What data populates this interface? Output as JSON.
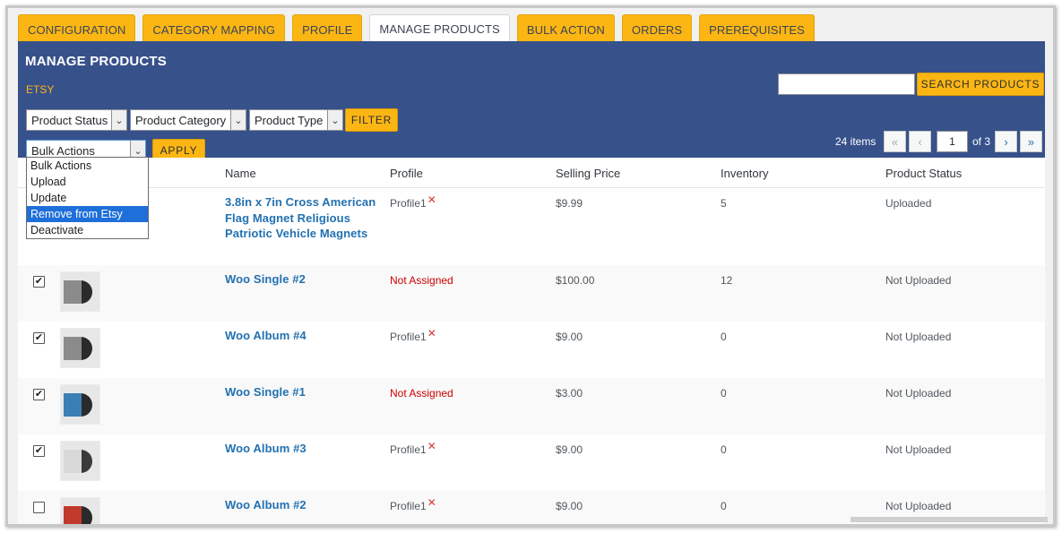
{
  "tabs": [
    {
      "label": "CONFIGURATION"
    },
    {
      "label": "CATEGORY MAPPING"
    },
    {
      "label": "PROFILE"
    },
    {
      "label": "MANAGE PRODUCTS"
    },
    {
      "label": "BULK ACTION"
    },
    {
      "label": "ORDERS"
    },
    {
      "label": "PREREQUISITES"
    }
  ],
  "active_tab": "MANAGE PRODUCTS",
  "panel": {
    "title": "MANAGE PRODUCTS",
    "subtitle": "ETSY",
    "search_button": "SEARCH PRODUCTS",
    "search_value": ""
  },
  "filters": {
    "status": "Product Status",
    "category": "Product Category",
    "type": "Product Type",
    "filter_button": "FILTER"
  },
  "bulk": {
    "selected": "Bulk Actions",
    "apply_button": "APPLY",
    "options": [
      "Bulk Actions",
      "Upload",
      "Update",
      "Remove from Etsy",
      "Deactivate"
    ],
    "highlighted": "Remove from Etsy"
  },
  "pagination": {
    "items": "24 items",
    "first": "«",
    "prev": "‹",
    "current": "1",
    "of": "of 3",
    "next": "›",
    "last": "»"
  },
  "columns": {
    "name": "Name",
    "profile": "Profile",
    "price": "Selling Price",
    "inventory": "Inventory",
    "status": "Product Status"
  },
  "rows": [
    {
      "checked": false,
      "name_lines": [
        "3.8in x 7in Cross American",
        "Flag Magnet Religious",
        "Patriotic Vehicle Magnets"
      ],
      "profile": "Profile1",
      "profile_assigned": true,
      "price": "$9.99",
      "inventory": "5",
      "status": "Uploaded",
      "thumb": "none"
    },
    {
      "checked": true,
      "name_lines": [
        "Woo Single #2"
      ],
      "profile": "Not Assigned",
      "profile_assigned": false,
      "price": "$100.00",
      "inventory": "12",
      "status": "Not Uploaded",
      "thumb": "album-grey"
    },
    {
      "checked": true,
      "name_lines": [
        "Woo Album #4"
      ],
      "profile": "Profile1",
      "profile_assigned": true,
      "price": "$9.00",
      "inventory": "0",
      "status": "Not Uploaded",
      "thumb": "album-grey"
    },
    {
      "checked": true,
      "name_lines": [
        "Woo Single #1"
      ],
      "profile": "Not Assigned",
      "profile_assigned": false,
      "price": "$3.00",
      "inventory": "0",
      "status": "Not Uploaded",
      "thumb": "album-blue"
    },
    {
      "checked": true,
      "name_lines": [
        "Woo Album #3"
      ],
      "profile": "Profile1",
      "profile_assigned": true,
      "price": "$9.00",
      "inventory": "0",
      "status": "Not Uploaded",
      "thumb": "album-white"
    },
    {
      "checked": false,
      "name_lines": [
        "Woo Album #2"
      ],
      "profile": "Profile1",
      "profile_assigned": true,
      "price": "$9.00",
      "inventory": "0",
      "status": "Not Uploaded",
      "thumb": "album-red"
    }
  ],
  "colors": {
    "accent": "#fbb614",
    "panel": "#37518b",
    "link": "#2271b1",
    "error": "#cc0000"
  },
  "icons": {
    "remove_profile": "close-x-icon",
    "dropdown": "chevron-down-icon"
  }
}
